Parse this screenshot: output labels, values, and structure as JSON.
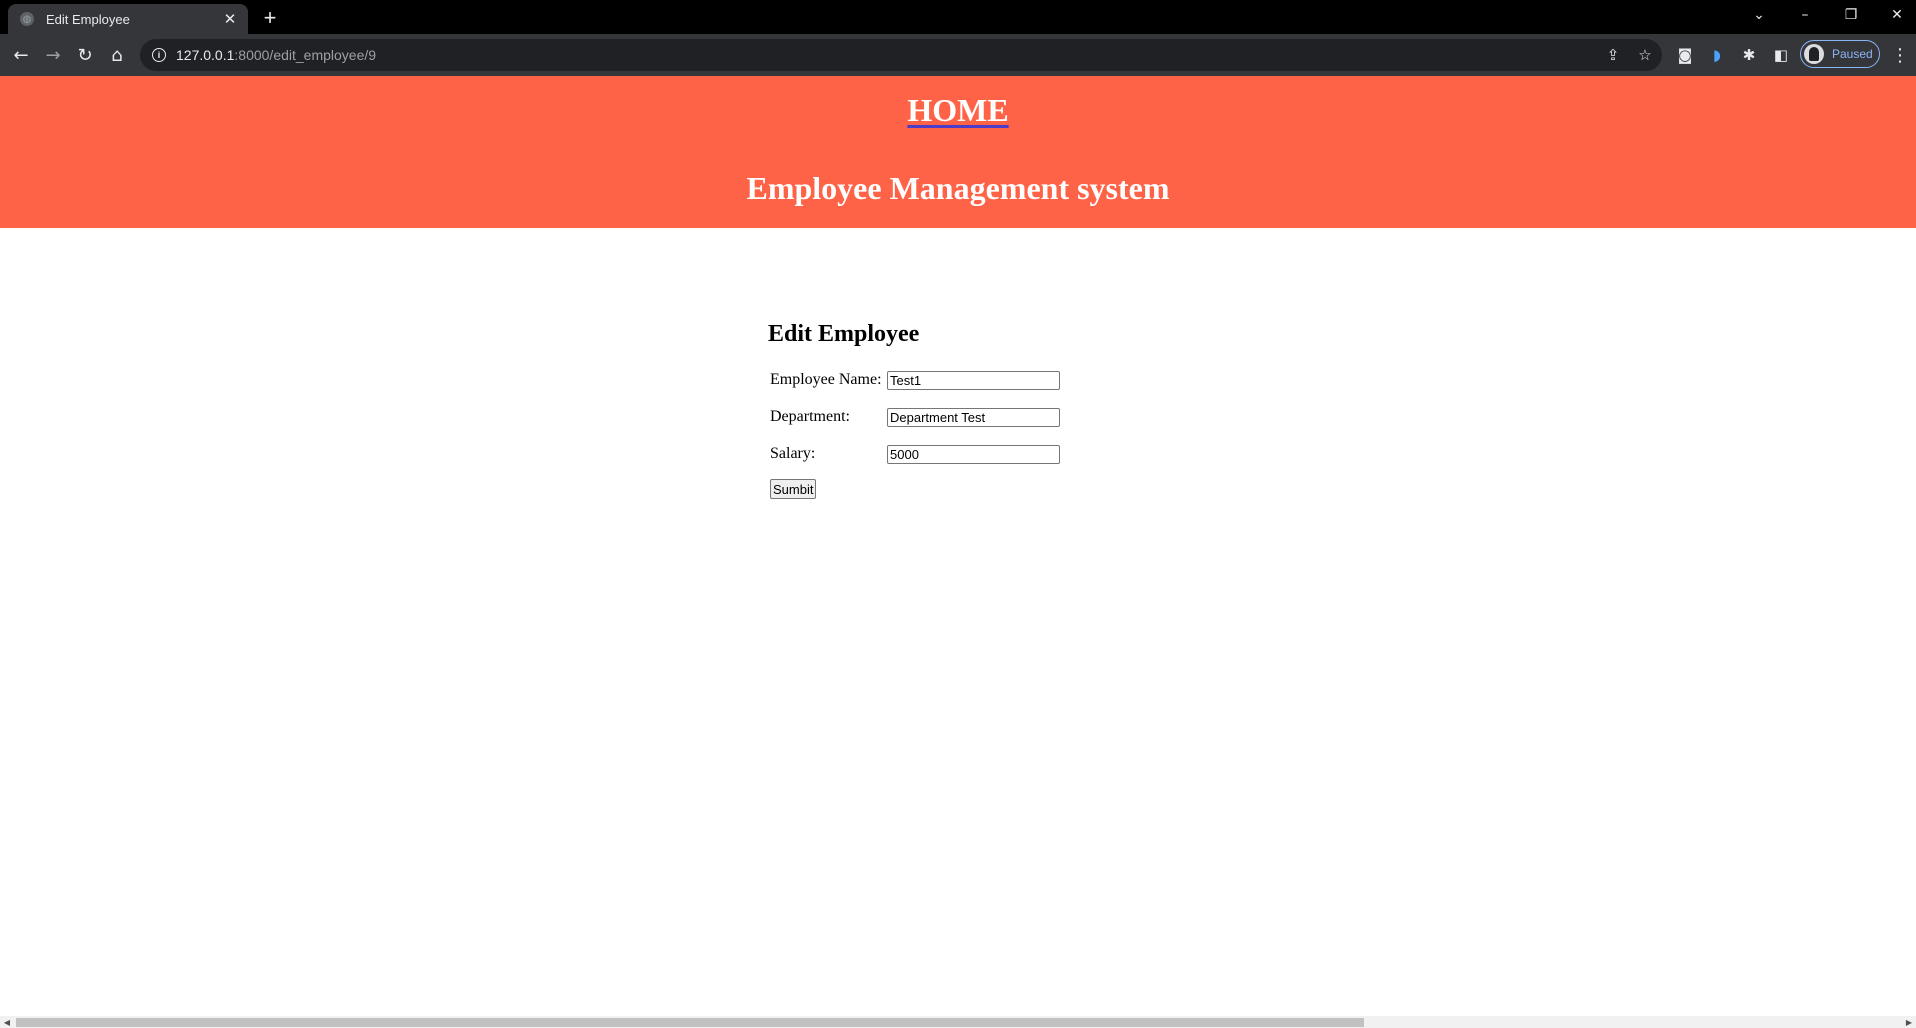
{
  "browser": {
    "tab_title": "Edit Employee",
    "tab_close": "✕",
    "new_tab": "+",
    "url_host": "127.0.0.1",
    "url_path": ":8000/edit_employee/9",
    "profile_status": "Paused",
    "icons": {
      "back": "back-arrow-icon",
      "forward": "forward-arrow-icon",
      "reload": "reload-icon",
      "home": "home-icon",
      "share": "share-icon",
      "bookmark": "star-icon",
      "camera": "camera-icon",
      "extension": "puzzle-icon",
      "sidepanel": "side-panel-icon",
      "menu": "kebab-menu-icon"
    },
    "colors": {
      "tabbar": "#000000",
      "toolbar": "#35363a",
      "omnibox": "#202124"
    }
  },
  "page": {
    "home_link": "HOME",
    "app_title": "Employee Management system",
    "header_color": "#ff6347",
    "form": {
      "title": "Edit Employee",
      "fields": [
        {
          "label": "Employee Name:",
          "value": "Test1"
        },
        {
          "label": "Department:",
          "value": "Department Test"
        },
        {
          "label": "Salary:",
          "value": "5000"
        }
      ],
      "submit_label": "Sumbit"
    }
  }
}
